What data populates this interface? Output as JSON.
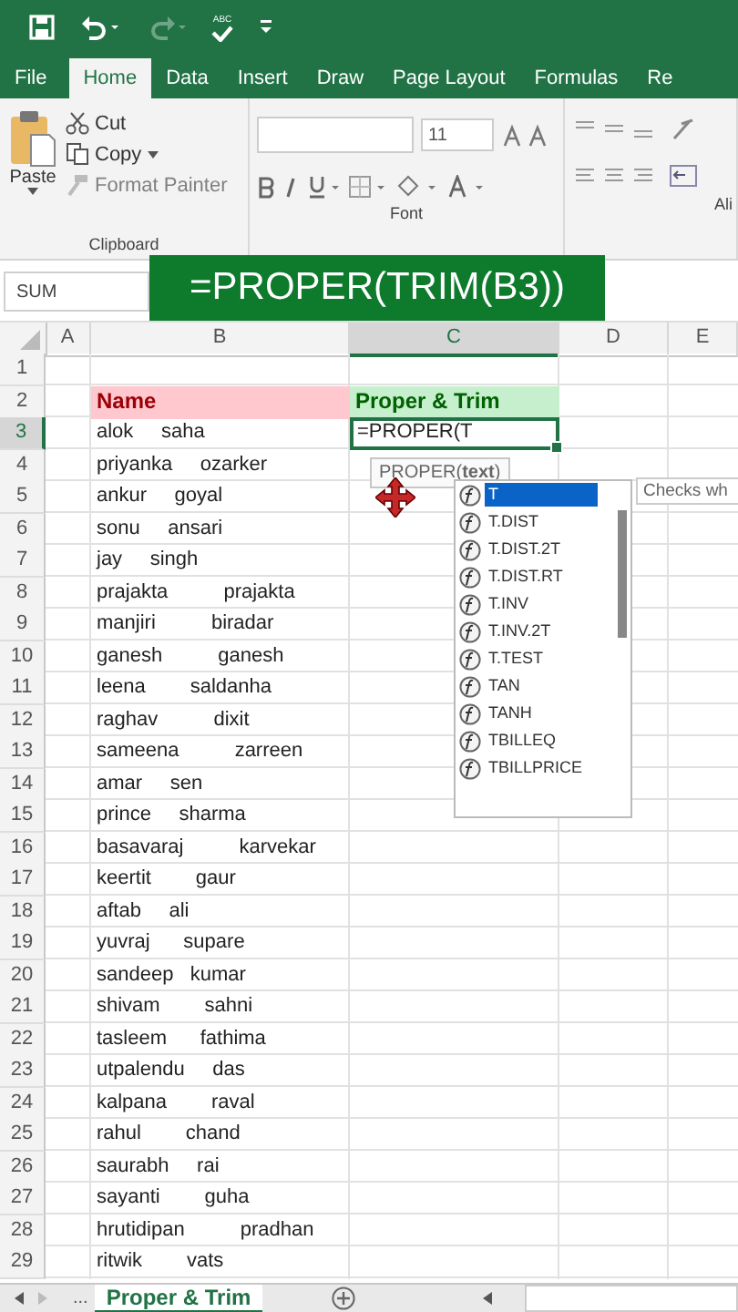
{
  "quick_access": [
    {
      "kind": "save",
      "disabled": false
    },
    {
      "kind": "undo",
      "disabled": false
    },
    {
      "kind": "redo",
      "disabled": true
    },
    {
      "kind": "spelling",
      "label": "ABC",
      "disabled": false
    },
    {
      "kind": "customize",
      "disabled": false
    }
  ],
  "tabs": [
    {
      "label": "File",
      "selected": false
    },
    {
      "label": "Home",
      "selected": true
    },
    {
      "label": "Data",
      "selected": false
    },
    {
      "label": "Insert",
      "selected": false
    },
    {
      "label": "Draw",
      "selected": false
    },
    {
      "label": "Page Layout",
      "selected": false
    },
    {
      "label": "Formulas",
      "selected": false
    },
    {
      "label": "Re",
      "selected": false
    }
  ],
  "ribbon": {
    "clipboard": {
      "title": "Clipboard",
      "paste": "Paste",
      "items": [
        {
          "kind": "cut",
          "label": "Cut",
          "disabled": false
        },
        {
          "kind": "copy",
          "label": "Copy",
          "disabled": false
        },
        {
          "kind": "painter",
          "label": "Format Painter",
          "disabled": true
        }
      ]
    },
    "font": {
      "title": "Font",
      "size": "11"
    },
    "alignment": {
      "title": "Ali"
    }
  },
  "formula_bar": {
    "name_box": "SUM"
  },
  "caption": "=PROPER(TRIM(B3))",
  "columns": [
    {
      "label": "A",
      "selected": false
    },
    {
      "label": "B",
      "selected": false
    },
    {
      "label": "C",
      "selected": true
    },
    {
      "label": "D",
      "selected": false
    },
    {
      "label": "E",
      "selected": false
    }
  ],
  "rows": [
    {
      "number": "1",
      "selected": false
    },
    {
      "number": "2",
      "selected": false,
      "b": {
        "kind": "name_header",
        "text": "Name"
      },
      "c": {
        "kind": "result_header",
        "text": "Proper & Trim"
      }
    },
    {
      "number": "3",
      "selected": true,
      "b": {
        "kind": "text",
        "text": "alok     saha"
      },
      "c": {
        "kind": "editing",
        "text": "=PROPER(T"
      }
    },
    {
      "number": "4",
      "selected": false,
      "b": {
        "kind": "text",
        "text": "priyanka     ozarker"
      }
    },
    {
      "number": "5",
      "selected": false,
      "b": {
        "kind": "text",
        "text": "ankur     goyal"
      }
    },
    {
      "number": "6",
      "selected": false,
      "b": {
        "kind": "text",
        "text": "sonu     ansari"
      }
    },
    {
      "number": "7",
      "selected": false,
      "b": {
        "kind": "text",
        "text": "jay     singh"
      }
    },
    {
      "number": "8",
      "selected": false,
      "b": {
        "kind": "text",
        "text": "prajakta          prajakta"
      }
    },
    {
      "number": "9",
      "selected": false,
      "b": {
        "kind": "text",
        "text": "manjiri          biradar"
      }
    },
    {
      "number": "10",
      "selected": false,
      "b": {
        "kind": "text",
        "text": "ganesh          ganesh"
      }
    },
    {
      "number": "11",
      "selected": false,
      "b": {
        "kind": "text",
        "text": "leena        saldanha"
      }
    },
    {
      "number": "12",
      "selected": false,
      "b": {
        "kind": "text",
        "text": "raghav          dixit"
      }
    },
    {
      "number": "13",
      "selected": false,
      "b": {
        "kind": "text",
        "text": "sameena          zarreen"
      }
    },
    {
      "number": "14",
      "selected": false,
      "b": {
        "kind": "text",
        "text": "amar     sen"
      }
    },
    {
      "number": "15",
      "selected": false,
      "b": {
        "kind": "text",
        "text": "prince     sharma"
      }
    },
    {
      "number": "16",
      "selected": false,
      "b": {
        "kind": "text",
        "text": "basavaraj          karvekar"
      }
    },
    {
      "number": "17",
      "selected": false,
      "b": {
        "kind": "text",
        "text": "keertit        gaur"
      }
    },
    {
      "number": "18",
      "selected": false,
      "b": {
        "kind": "text",
        "text": "aftab     ali"
      }
    },
    {
      "number": "19",
      "selected": false,
      "b": {
        "kind": "text",
        "text": "yuvraj      supare"
      }
    },
    {
      "number": "20",
      "selected": false,
      "b": {
        "kind": "text",
        "text": "sandeep   kumar"
      }
    },
    {
      "number": "21",
      "selected": false,
      "b": {
        "kind": "text",
        "text": "shivam        sahni"
      }
    },
    {
      "number": "22",
      "selected": false,
      "b": {
        "kind": "text",
        "text": "tasleem      fathima"
      }
    },
    {
      "number": "23",
      "selected": false,
      "b": {
        "kind": "text",
        "text": "utpalendu     das"
      }
    },
    {
      "number": "24",
      "selected": false,
      "b": {
        "kind": "text",
        "text": "kalpana        raval"
      }
    },
    {
      "number": "25",
      "selected": false,
      "b": {
        "kind": "text",
        "text": "rahul        chand"
      }
    },
    {
      "number": "26",
      "selected": false,
      "b": {
        "kind": "text",
        "text": "saurabh     rai"
      }
    },
    {
      "number": "27",
      "selected": false,
      "b": {
        "kind": "text",
        "text": "sayanti        guha"
      }
    },
    {
      "number": "28",
      "selected": false,
      "b": {
        "kind": "text",
        "text": "hrutidipan          pradhan"
      }
    },
    {
      "number": "29",
      "selected": false,
      "b": {
        "kind": "text",
        "text": "ritwik        vats"
      }
    }
  ],
  "autocomplete": {
    "tooltip": "PROPER(**text**)",
    "description": "Checks wh",
    "items": [
      {
        "label": "T",
        "selected": true
      },
      {
        "label": "T.DIST",
        "selected": false
      },
      {
        "label": "T.DIST.2T",
        "selected": false
      },
      {
        "label": "T.DIST.RT",
        "selected": false
      },
      {
        "label": "T.INV",
        "selected": false
      },
      {
        "label": "T.INV.2T",
        "selected": false
      },
      {
        "label": "T.TEST",
        "selected": false
      },
      {
        "label": "TAN",
        "selected": false
      },
      {
        "label": "TANH",
        "selected": false
      },
      {
        "label": "TBILLEQ",
        "selected": false
      },
      {
        "label": "TBILLPRICE",
        "selected": false
      }
    ]
  },
  "sheet_tabs": {
    "more": "...",
    "tabs": [
      {
        "label": "Proper & Trim",
        "selected": true
      }
    ]
  }
}
